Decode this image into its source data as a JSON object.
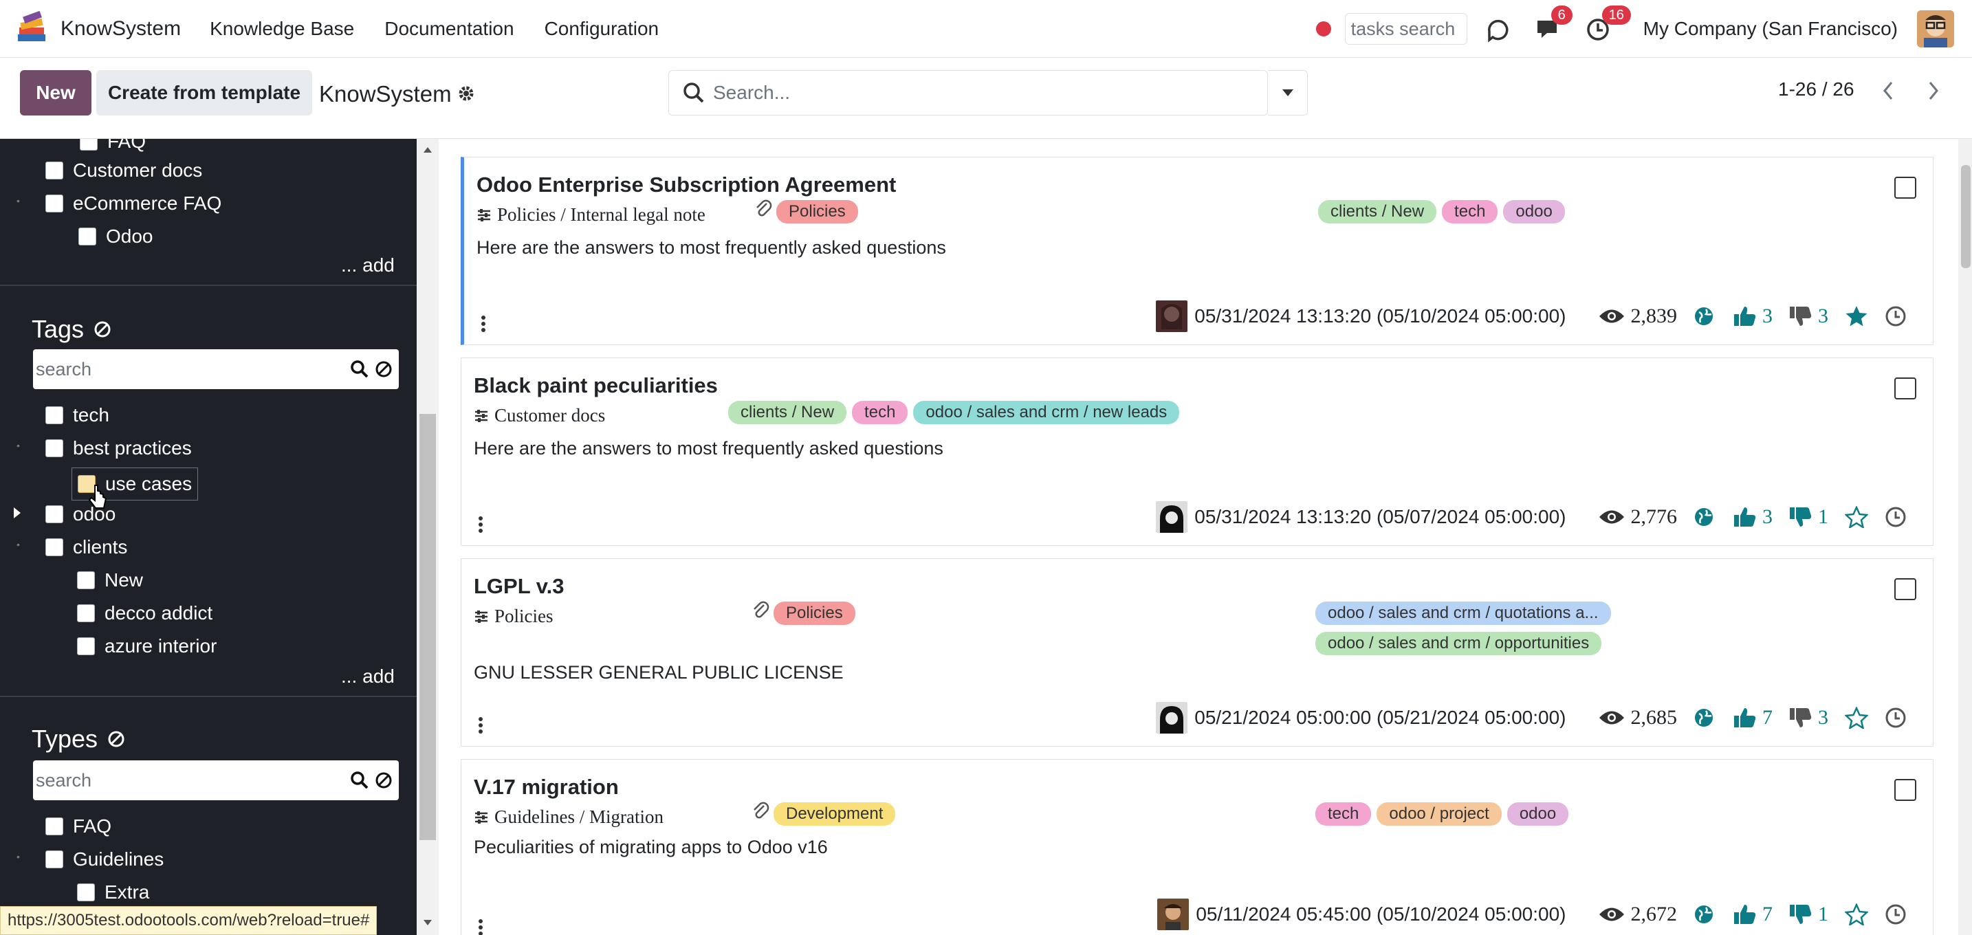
{
  "app": {
    "brand": "KnowSystem"
  },
  "nav": {
    "menu": [
      "Knowledge Base",
      "Documentation",
      "Configuration"
    ],
    "tasks_placeholder": "tasks search",
    "chat_badge": "6",
    "activity_badge": "16",
    "company": "My Company (San Francisco)"
  },
  "control": {
    "new_label": "New",
    "template_label": "Create from template",
    "title": "KnowSystem",
    "search_placeholder": "Search...",
    "pager": "1-26 / 26"
  },
  "sidebar": {
    "top_items": [
      "FAQ",
      "Customer docs",
      "eCommerce FAQ",
      "Odoo"
    ],
    "add_label": "... add",
    "tags_title": "Tags",
    "tags_search_placeholder": "search",
    "tags": [
      "tech",
      "best practices",
      "use cases",
      "odoo",
      "clients",
      "New",
      "decco addict",
      "azure interior"
    ],
    "types_title": "Types",
    "types_search_placeholder": "search",
    "types": [
      "FAQ",
      "Guidelines",
      "Extra"
    ]
  },
  "articles": [
    {
      "title": "Odoo Enterprise Subscription Agreement",
      "section": "Policies / Internal legal note",
      "type_tag": "Policies",
      "tags": [
        "clients / New",
        "tech",
        "odoo"
      ],
      "desc": "Here are the answers to most frequently asked questions",
      "dates": "05/31/2024 13:13:20 (05/10/2024 05:00:00)",
      "views": "2,839",
      "likes": "3",
      "dislikes": "3"
    },
    {
      "title": "Black paint peculiarities",
      "section": "Customer docs",
      "tags": [
        "clients / New",
        "tech",
        "odoo / sales and crm / new leads"
      ],
      "desc": "Here are the answers to most frequently asked questions",
      "dates": "05/31/2024 13:13:20 (05/07/2024 05:00:00)",
      "views": "2,776",
      "likes": "3",
      "dislikes": "1"
    },
    {
      "title": "LGPL v.3",
      "section": "Policies",
      "type_tag": "Policies",
      "tags": [
        "odoo / sales and crm / quotations a...",
        "odoo / sales and crm / opportunities"
      ],
      "desc": "GNU LESSER GENERAL PUBLIC LICENSE",
      "dates": "05/21/2024 05:00:00 (05/21/2024 05:00:00)",
      "views": "2,685",
      "likes": "7",
      "dislikes": "3"
    },
    {
      "title": "V.17 migration",
      "section": "Guidelines / Migration",
      "type_tag": "Development",
      "tags": [
        "tech",
        "odoo / project",
        "odoo"
      ],
      "desc": "Peculiarities of migrating apps to Odoo v16",
      "dates": "05/11/2024 05:45:00 (05/10/2024 05:00:00)",
      "views": "2,672",
      "likes": "7",
      "dislikes": "1"
    }
  ],
  "status_url": "https://3005test.odootools.com/web?reload=true#",
  "colors": {
    "primary": "#714b67",
    "accent": "#0e7c86",
    "sidebar_bg": "#1e2228"
  }
}
